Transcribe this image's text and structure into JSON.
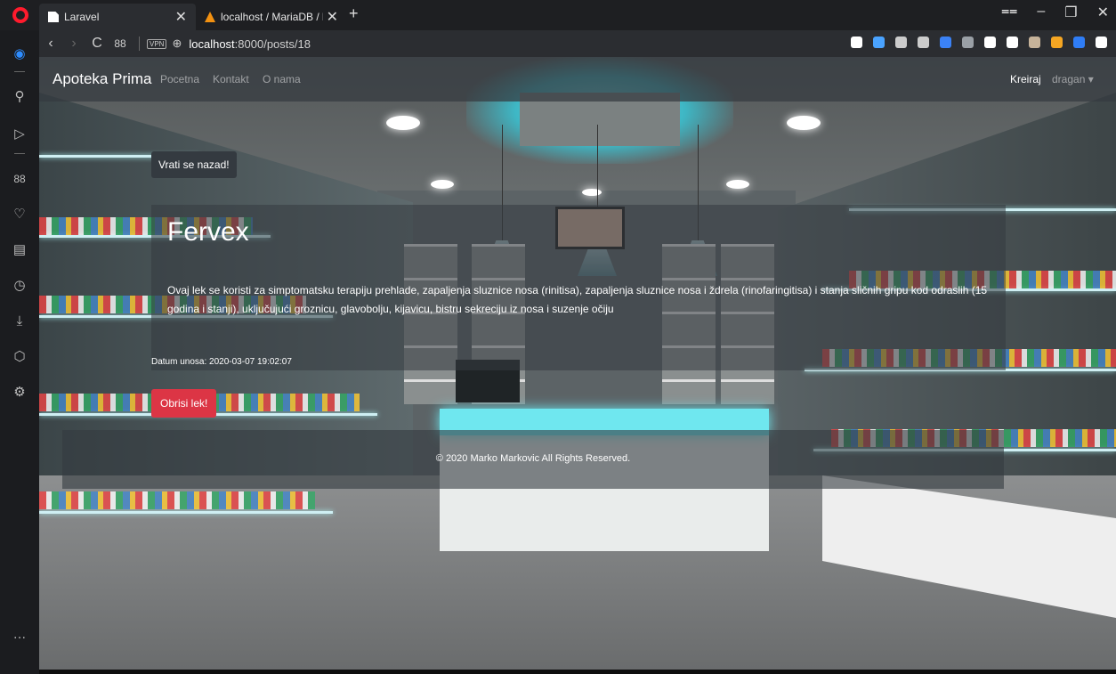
{
  "browser": {
    "tabs": [
      {
        "title": "Laravel",
        "close": "✕"
      },
      {
        "title": "localhost / MariaDB / baza",
        "close": "✕"
      }
    ],
    "new_tab": "+",
    "url_host": "localhost",
    "url_path": ":8000/posts/18",
    "vpn_label": "VPN",
    "window_controls": [
      "⩵",
      "–",
      "❐",
      "✕"
    ],
    "nav": {
      "back": "‹",
      "forward": "›",
      "reload": "C",
      "speed_dial": "88"
    },
    "extension_colors": [
      "#ffffff",
      "#4aa3ff",
      "#cccccc",
      "#cccccc",
      "#3b82f6",
      "#9aa0a6",
      "#ffffff",
      "#ffffff",
      "#c6b39a",
      "#f5a623",
      "#2f7df6",
      "#ffffff"
    ]
  },
  "sidebar": {
    "icons": [
      "messenger-icon",
      "search-icon",
      "send-icon",
      "speed-dial-icon",
      "heart-icon",
      "news-icon",
      "history-icon",
      "download-icon",
      "cube-icon",
      "settings-icon",
      "more-icon"
    ],
    "more_label": "…"
  },
  "site": {
    "brand": "Apoteka Prima",
    "nav_links": [
      "Pocetna",
      "Kontakt",
      "O nama"
    ],
    "nav_right": {
      "create": "Kreiraj",
      "user": "dragan ▾"
    }
  },
  "post": {
    "back_button": "Vrati se nazad!",
    "title": "Fervex",
    "body": "Ovaj lek se koristi za simptomatsku terapiju prehlade, zapaljenja sluznice nosa (rinitisa), zapaljenja sluznice nosa i ždrela (rinofaringitisa) i stanja sličnih gripu kod odraslih (15 godina i stanji), uključujući groznicu, glavobolju, kijavicu, bistru sekreciju iz nosa i suzenje očiju",
    "date": "Datum unosa: 2020-03-07 19:02:07",
    "delete_button": "Obrisi lek!"
  },
  "footer": {
    "text": "© 2020 Marko Markovic All Rights Reserved."
  },
  "colors": {
    "danger": "#dc3545",
    "dark": "#343a40",
    "opera_red": "#ff1b2d"
  }
}
